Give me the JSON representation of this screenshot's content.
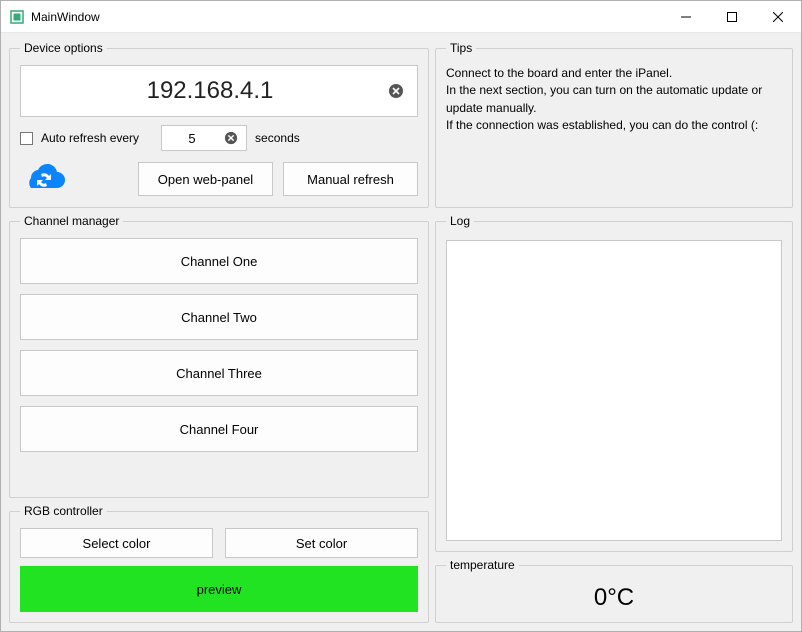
{
  "window": {
    "title": "MainWindow"
  },
  "device_options": {
    "legend": "Device options",
    "ip": "192.168.4.1",
    "auto_refresh_label": "Auto refresh every",
    "auto_refresh_seconds": "5",
    "seconds_label": "seconds",
    "open_web_panel": "Open web-panel",
    "manual_refresh": "Manual refresh"
  },
  "tips": {
    "legend": "Tips",
    "text": "Connect to the board and enter the iPanel.\nIn the next section, you can turn on the automatic update or update manually.\nIf the connection was established, you can do the control (:"
  },
  "channel_manager": {
    "legend": "Channel manager",
    "channels": [
      "Channel One",
      "Channel Two",
      "Channel Three",
      "Channel Four"
    ]
  },
  "log": {
    "legend": "Log",
    "content": ""
  },
  "rgb": {
    "legend": "RGB controller",
    "select_color": "Select color",
    "set_color": "Set color",
    "preview_label": "preview",
    "preview_color": "#21e321"
  },
  "temperature": {
    "legend": "temperature",
    "value": "0°C"
  }
}
